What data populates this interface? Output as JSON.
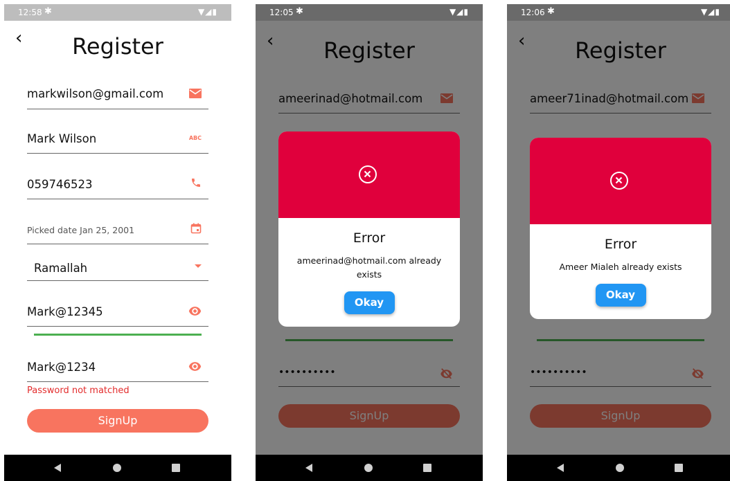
{
  "colors": {
    "accent": "#f8745f",
    "error_red": "#e32c2c",
    "dialog_red": "#e0003c",
    "dialog_button": "#2196f3",
    "strength_green": "#4caf50"
  },
  "phones": [
    {
      "status": {
        "time": "12:58"
      },
      "title": "Register",
      "form": {
        "email": "markwilson@gmail.com",
        "name": "Mark Wilson",
        "name_icon_text": "ABC",
        "phone": "059746523",
        "date": "Picked date Jan 25, 2001",
        "city": "Ramallah",
        "password": "Mark@12345",
        "confirm_password": "Mark@1234",
        "error": "Password not matched",
        "signup": "SignUp"
      }
    },
    {
      "status": {
        "time": "12:05"
      },
      "title": "Register",
      "form": {
        "email": "ameerinad@hotmail.com",
        "confirm_password": "••••••••••",
        "signup": "SignUp"
      },
      "dialog": {
        "title": "Error",
        "message": "ameerinad@hotmail.com already exists",
        "button": "Okay"
      }
    },
    {
      "status": {
        "time": "12:06"
      },
      "title": "Register",
      "form": {
        "email": "ameer71inad@hotmail.com",
        "confirm_password": "••••••••••",
        "signup": "SignUp"
      },
      "dialog": {
        "title": "Error",
        "message": "Ameer Mialeh already exists",
        "button": "Okay"
      }
    }
  ]
}
